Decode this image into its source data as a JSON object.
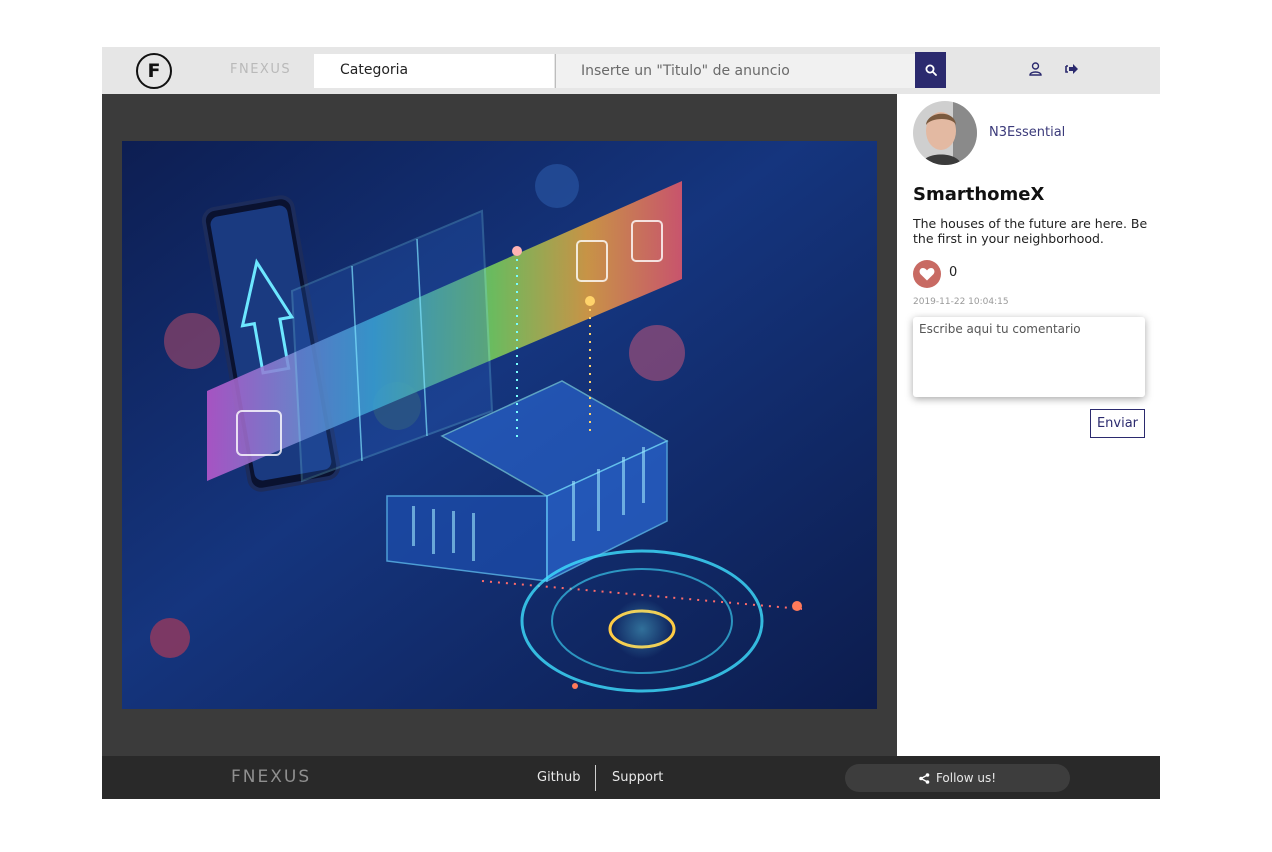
{
  "header": {
    "logo_letter": "F",
    "brand": "FNEXUS",
    "category_label": "Categoria",
    "search_placeholder": "Inserte un \"Titulo\" de anuncio",
    "icons": [
      "search-icon",
      "user-icon",
      "logout-icon"
    ],
    "accent_color": "#2b2a6e"
  },
  "post": {
    "author": "N3Essential",
    "title": "SmarthomeX",
    "description": "The houses of the future are here. Be the first in your neighborhood.",
    "likes": "0",
    "date": "2019-11-22 10:04:15",
    "comment_placeholder": "Escribe aqui tu comentario",
    "send_label": "Enviar",
    "like_color": "#c86a63"
  },
  "footer": {
    "brand": "FNEXUS",
    "links": [
      "Github",
      "Support"
    ],
    "follow_label": "Follow us!"
  }
}
